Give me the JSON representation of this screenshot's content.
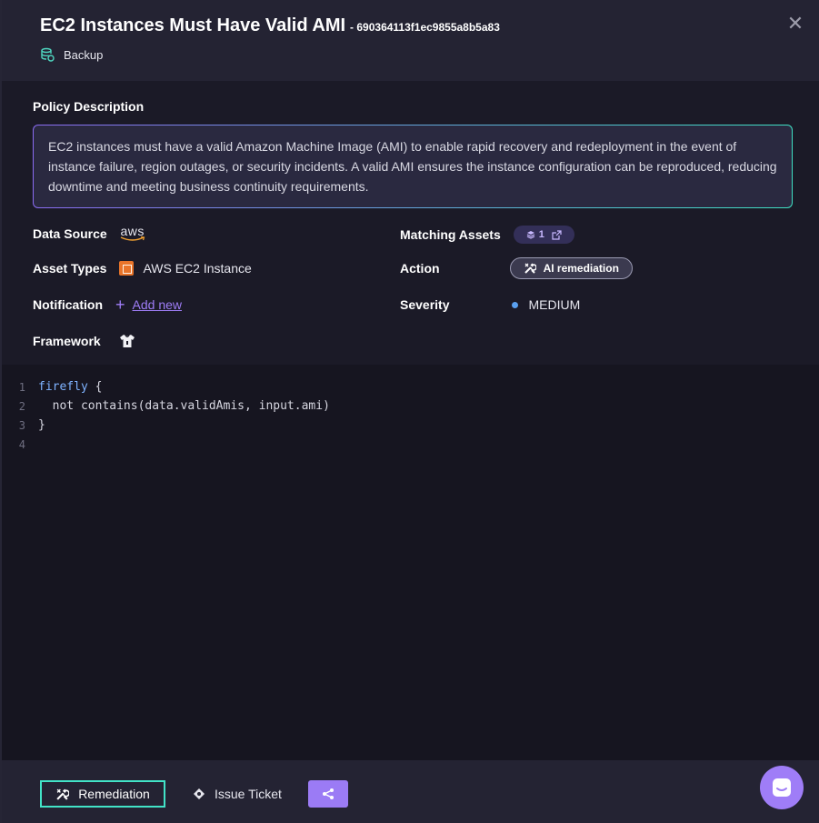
{
  "header": {
    "title": "EC2 Instances Must Have Valid AMI",
    "policy_id": "- 690364113f1ec9855a8b5a83",
    "close_symbol": "✕",
    "category": "Backup"
  },
  "description": {
    "title": "Policy Description",
    "text": "EC2 instances must have a valid Amazon Machine Image (AMI) to enable rapid recovery and redeployment in the event of instance failure, region outages, or security incidents. A valid AMI ensures the instance configuration can be reproduced, reducing downtime and meeting business continuity requirements."
  },
  "fields": {
    "data_source": {
      "label": "Data Source",
      "value": "aws"
    },
    "asset_types": {
      "label": "Asset Types",
      "value": "AWS EC2 Instance"
    },
    "notification": {
      "label": "Notification",
      "plus": "+",
      "link": "Add new"
    },
    "framework": {
      "label": "Framework"
    },
    "matching_assets": {
      "label": "Matching Assets",
      "count": "1"
    },
    "action": {
      "label": "Action",
      "button": "AI remediation"
    },
    "severity": {
      "label": "Severity",
      "value": "MEDIUM",
      "color": "#5aa0f0"
    }
  },
  "code": {
    "lines": [
      {
        "n": "1",
        "kw": "firefly",
        "rest": " {"
      },
      {
        "n": "2",
        "kw": "",
        "rest": "  not contains(data.validAmis, input.ami)"
      },
      {
        "n": "3",
        "kw": "",
        "rest": "}"
      },
      {
        "n": "4",
        "kw": "",
        "rest": ""
      }
    ]
  },
  "footer": {
    "remediation": "Remediation",
    "issue_ticket": "Issue Ticket"
  },
  "colors": {
    "accent": "#9f7df7",
    "teal": "#42e3c7"
  }
}
